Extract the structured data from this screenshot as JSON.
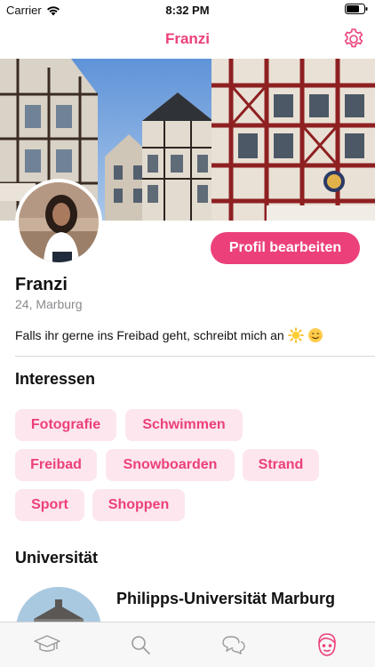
{
  "status_bar": {
    "carrier": "Carrier",
    "time": "8:32 PM"
  },
  "nav": {
    "title": "Franzi",
    "settings_icon": "gear-icon"
  },
  "profile": {
    "name": "Franzi",
    "age_location": "24, Marburg",
    "bio": "Falls ihr gerne ins Freibad geht, schreibt mich an",
    "bio_emojis": [
      "sun-emoji",
      "smiling-face-emoji"
    ],
    "edit_button_label": "Profil bearbeiten"
  },
  "interests": {
    "title": "Interessen",
    "tags": [
      "Fotografie",
      "Schwimmen",
      "Freibad",
      "Snowboarden",
      "Strand",
      "Sport",
      "Shoppen"
    ]
  },
  "university": {
    "title": "Universität",
    "name": "Philipps-Universität Marburg"
  },
  "tab_bar": {
    "tabs": [
      {
        "icon": "graduation-cap-icon"
      },
      {
        "icon": "search-icon"
      },
      {
        "icon": "chat-bubbles-icon"
      },
      {
        "icon": "profile-face-icon",
        "active": true
      }
    ]
  },
  "colors": {
    "accent": "#ec407a",
    "tag_bg": "#fde6ee",
    "secondary_text": "#8a8a8f"
  }
}
